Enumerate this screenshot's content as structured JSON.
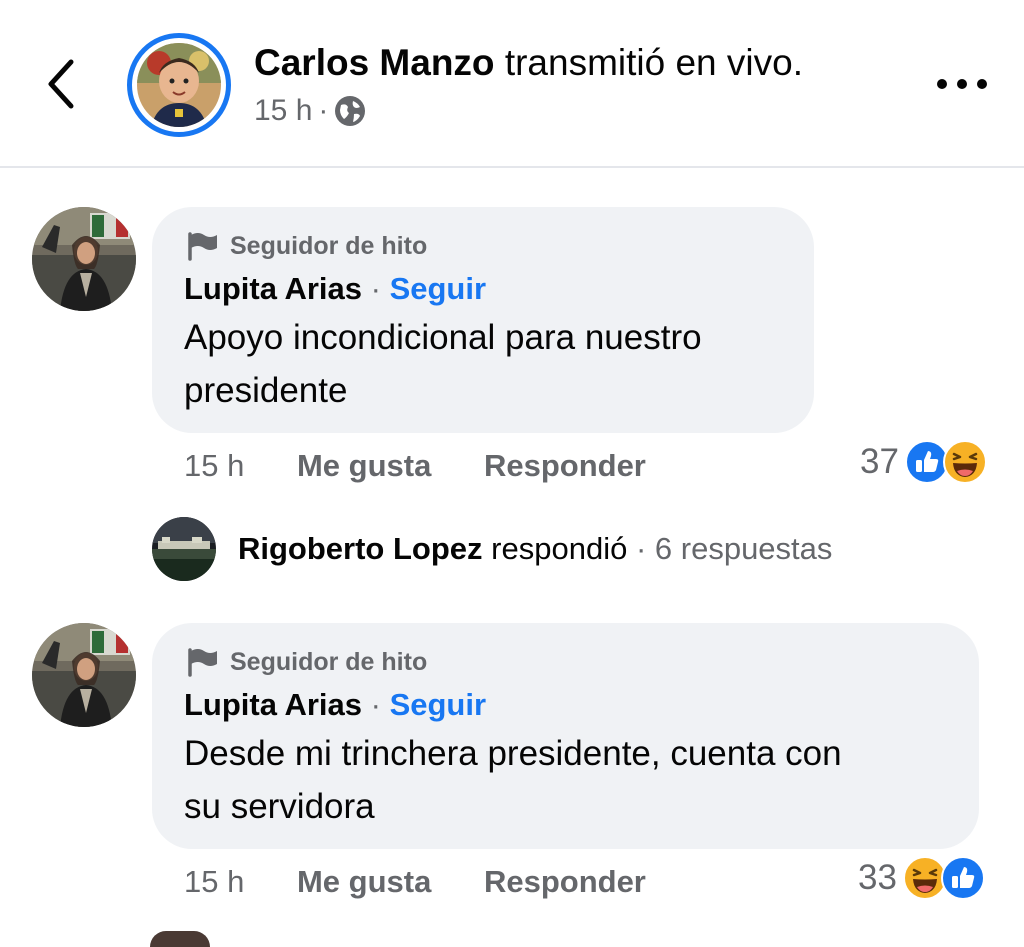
{
  "colors": {
    "accent": "#1877f2",
    "bubble": "#f0f2f5",
    "muted": "#65676b",
    "text": "#050505"
  },
  "header": {
    "author": "Carlos Manzo",
    "action": "transmitió en vivo.",
    "time": "15 h",
    "separator": "·",
    "audience_icon": "globe-icon",
    "back_icon": "chevron-left-icon",
    "more_icon": "more-horizontal-icon"
  },
  "comments": [
    {
      "badge": "Seguidor de hito",
      "badge_icon": "flag-icon",
      "author": "Lupita Arias",
      "separator": "·",
      "follow": "Seguir",
      "text_lines": [
        "Apoyo incondicional para nuestro",
        "presidente"
      ],
      "time": "15 h",
      "like": "Me gusta",
      "reply": "Responder",
      "reaction_count": "37",
      "reactions": [
        "like-icon",
        "haha-icon"
      ]
    },
    {
      "badge": "Seguidor de hito",
      "badge_icon": "flag-icon",
      "author": "Lupita Arias",
      "separator": "·",
      "follow": "Seguir",
      "text_lines": [
        "Desde mi trinchera presidente, cuenta con",
        "su servidora"
      ],
      "time": "15 h",
      "like": "Me gusta",
      "reply": "Responder",
      "reaction_count": "33",
      "reactions": [
        "haha-icon",
        "like-icon"
      ]
    }
  ],
  "reply_summary": {
    "author": "Rigoberto Lopez",
    "action": "respondió",
    "separator": "·",
    "count_text": "6 respuestas"
  }
}
